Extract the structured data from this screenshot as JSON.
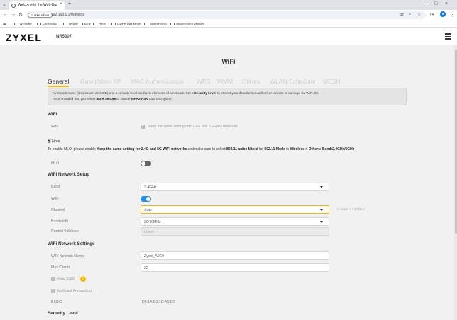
{
  "browser": {
    "tab_title": "Welcome to the Web-Based C",
    "new_tab": "+",
    "url_warning": "Ikke sikker",
    "url": "192.168.1.1/Wireless",
    "bookmarks": [
      "Nyheder",
      "Lockerdan",
      "Rejsel",
      "Emy",
      "Hjem",
      "GDPR blanketter",
      "SharePoints",
      "September nyheder"
    ]
  },
  "header": {
    "brand": "ZYXEL",
    "model": "NR5307"
  },
  "page": {
    "title": "WiFi",
    "tabs": [
      "General",
      "Guest/More AP",
      "MAC Authentication",
      "WPS",
      "WMM",
      "Others",
      "WLAN Scheduler",
      "MESH"
    ],
    "info_line1_a": "A network name (also known as SSID) and a security level are basic elements of a network. Set a ",
    "info_line1_b": "Security Level",
    "info_line1_c": " to protect your data from unauthorized access or damage via WiFi. It's",
    "info_line2_a": "recommended that you select ",
    "info_line2_b": "More Secure",
    "info_line2_c": " to enable ",
    "info_line2_d": "WPA2-PSK",
    "info_line2_e": " data encryption."
  },
  "wifi_section": {
    "title": "WiFi",
    "wifi_label": "WiFi",
    "keep_same_label": "Keep the same settings for 2.4G and 5G WiFi networks",
    "keep_same_checked": true
  },
  "note": {
    "header": "Note",
    "t1": "To enable MLO, please enable ",
    "t2": "Keep the same setting for 2.4G and 5G WiFi networks",
    "t3": " and make sure to select ",
    "t4": "802.11 ax/be Mixed",
    "t5": " for ",
    "t6": "802.11 Mode",
    "t7": " in ",
    "t8": "Wireless > Others: Band:2.4GHz/5GHz",
    "mlo_label": "MLO",
    "mlo_on": false
  },
  "setup": {
    "title": "WiFi Network Setup",
    "band_label": "Band",
    "band_value": "2.4GHz",
    "wifi_label": "WiFi",
    "wifi_on": true,
    "channel_label": "Channel",
    "channel_value": "Auto",
    "channel_hint": "Current: 1 / 20 MHz",
    "bandwidth_label": "Bandwidth",
    "bandwidth_value": "20/40MHz",
    "sideband_label": "Control Sideband",
    "sideband_value": "Lower"
  },
  "settings": {
    "title": "WiFi Network Settings",
    "name_label": "WiFi Network Name",
    "name_value": "Zyxel_A0E9",
    "max_label": "Max Clients",
    "max_value": "32",
    "hide_ssid_label": "Hide SSID",
    "hide_ssid_checked": false,
    "multicast_label": "Multicast Forwarding",
    "multicast_checked": true,
    "bssid_label": "BSSID",
    "bssid_value": "D4:1A:D1:1D:A0:E9"
  },
  "security": {
    "title": "Security Level"
  }
}
